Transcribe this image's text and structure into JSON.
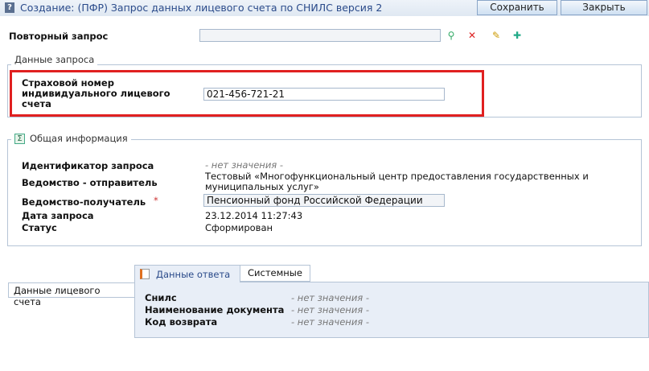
{
  "header": {
    "title": "Создание: (ПФР) Запрос данных лицевого счета по СНИЛС версия 2",
    "save": "Сохранить",
    "close": "Закрыть"
  },
  "repeat": {
    "label": "Повторный запрос",
    "value": ""
  },
  "request": {
    "legend": "Данные запроса",
    "snils_label": "Страховой номер индивидуального лицевого счета",
    "snils_value": "021-456-721-21",
    "highlight": "#e02020"
  },
  "general": {
    "legend": "Общая информация",
    "rows": [
      {
        "label": "Идентификатор запроса",
        "value": "- нет значения -"
      },
      {
        "label": "Ведомство - отправитель",
        "value": "Тестовый «Многофункциональный центр предоставления государственных и муниципальных услуг»"
      },
      {
        "label": "Ведомство-получатель",
        "value": "Пенсионный фонд Российской Федерации",
        "required": "*"
      },
      {
        "label": "Дата запроса",
        "value": "23.12.2014 11:27:43"
      },
      {
        "label": "Статус",
        "value": "Сформирован"
      }
    ]
  },
  "account": {
    "section_label": "Данные лицевого счета",
    "tabs": [
      "Данные ответа",
      "Системные"
    ],
    "rows": [
      {
        "label": "Снилс",
        "value": "- нет значения -"
      },
      {
        "label": "Наименование документа",
        "value": "- нет значения -"
      },
      {
        "label": "Код возврата",
        "value": "- нет значения -"
      }
    ]
  }
}
